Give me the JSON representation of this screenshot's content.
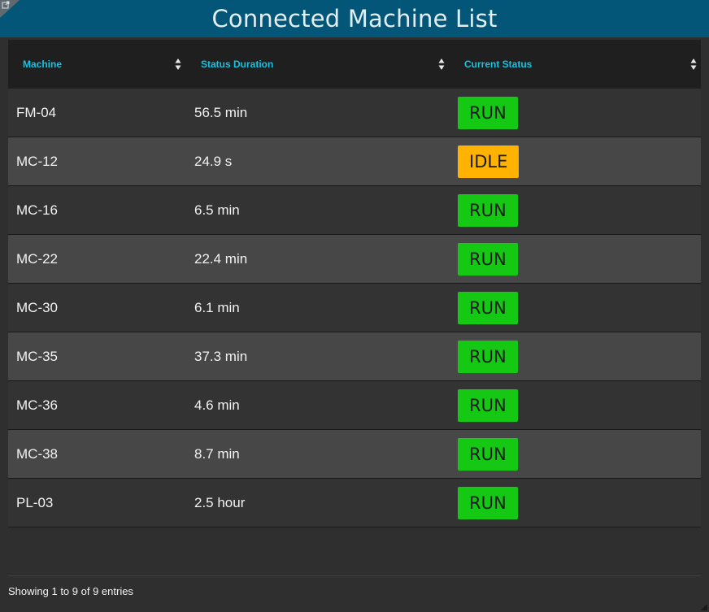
{
  "header": {
    "title": "Connected Machine List",
    "color": "#035677"
  },
  "table": {
    "columns": [
      {
        "label": "Machine"
      },
      {
        "label": "Status Duration"
      },
      {
        "label": "Current Status"
      }
    ],
    "rows": [
      {
        "machine": "FM-04",
        "duration": "56.5 min",
        "status": "RUN"
      },
      {
        "machine": "MC-12",
        "duration": "24.9 s",
        "status": "IDLE"
      },
      {
        "machine": "MC-16",
        "duration": "6.5 min",
        "status": "RUN"
      },
      {
        "machine": "MC-22",
        "duration": "22.4 min",
        "status": "RUN"
      },
      {
        "machine": "MC-30",
        "duration": "6.1 min",
        "status": "RUN"
      },
      {
        "machine": "MC-35",
        "duration": "37.3 min",
        "status": "RUN"
      },
      {
        "machine": "MC-36",
        "duration": "4.6 min",
        "status": "RUN"
      },
      {
        "machine": "MC-38",
        "duration": "8.7 min",
        "status": "RUN"
      },
      {
        "machine": "PL-03",
        "duration": "2.5 hour",
        "status": "RUN"
      }
    ]
  },
  "status_colors": {
    "RUN": "#14c814",
    "IDLE": "#ffb300"
  },
  "footer": {
    "info": "Showing 1 to 9 of 9 entries"
  },
  "icons": {
    "corner": "external-link-icon",
    "sort": "sort-icon",
    "resize": "resize-handle-icon"
  }
}
